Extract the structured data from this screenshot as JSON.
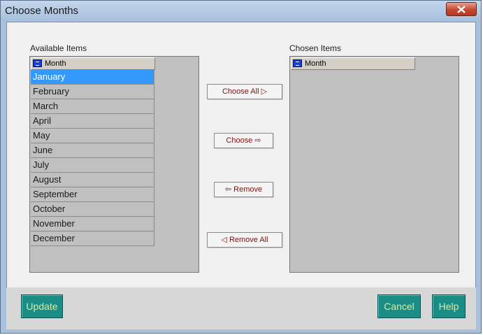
{
  "window": {
    "title": "Choose Months"
  },
  "available": {
    "label": "Available Items",
    "column_header": "Month",
    "items": [
      "January",
      "February",
      "March",
      "April",
      "May",
      "June",
      "July",
      "August",
      "September",
      "October",
      "November",
      "December"
    ],
    "selected_index": 0
  },
  "chosen": {
    "label": "Chosen Items",
    "column_header": "Month",
    "items": []
  },
  "actions": {
    "choose_all": "Choose All ▷",
    "choose": "Choose ⇨",
    "remove": "⇦ Remove",
    "remove_all": "◁ Remove All"
  },
  "footer": {
    "update": "Update",
    "cancel": "Cancel",
    "help": "Help"
  },
  "colors": {
    "selection": "#3399ff",
    "teal_button": "#1a8e86",
    "button_text": "#d6e8a8",
    "action_text": "#7a1010"
  }
}
